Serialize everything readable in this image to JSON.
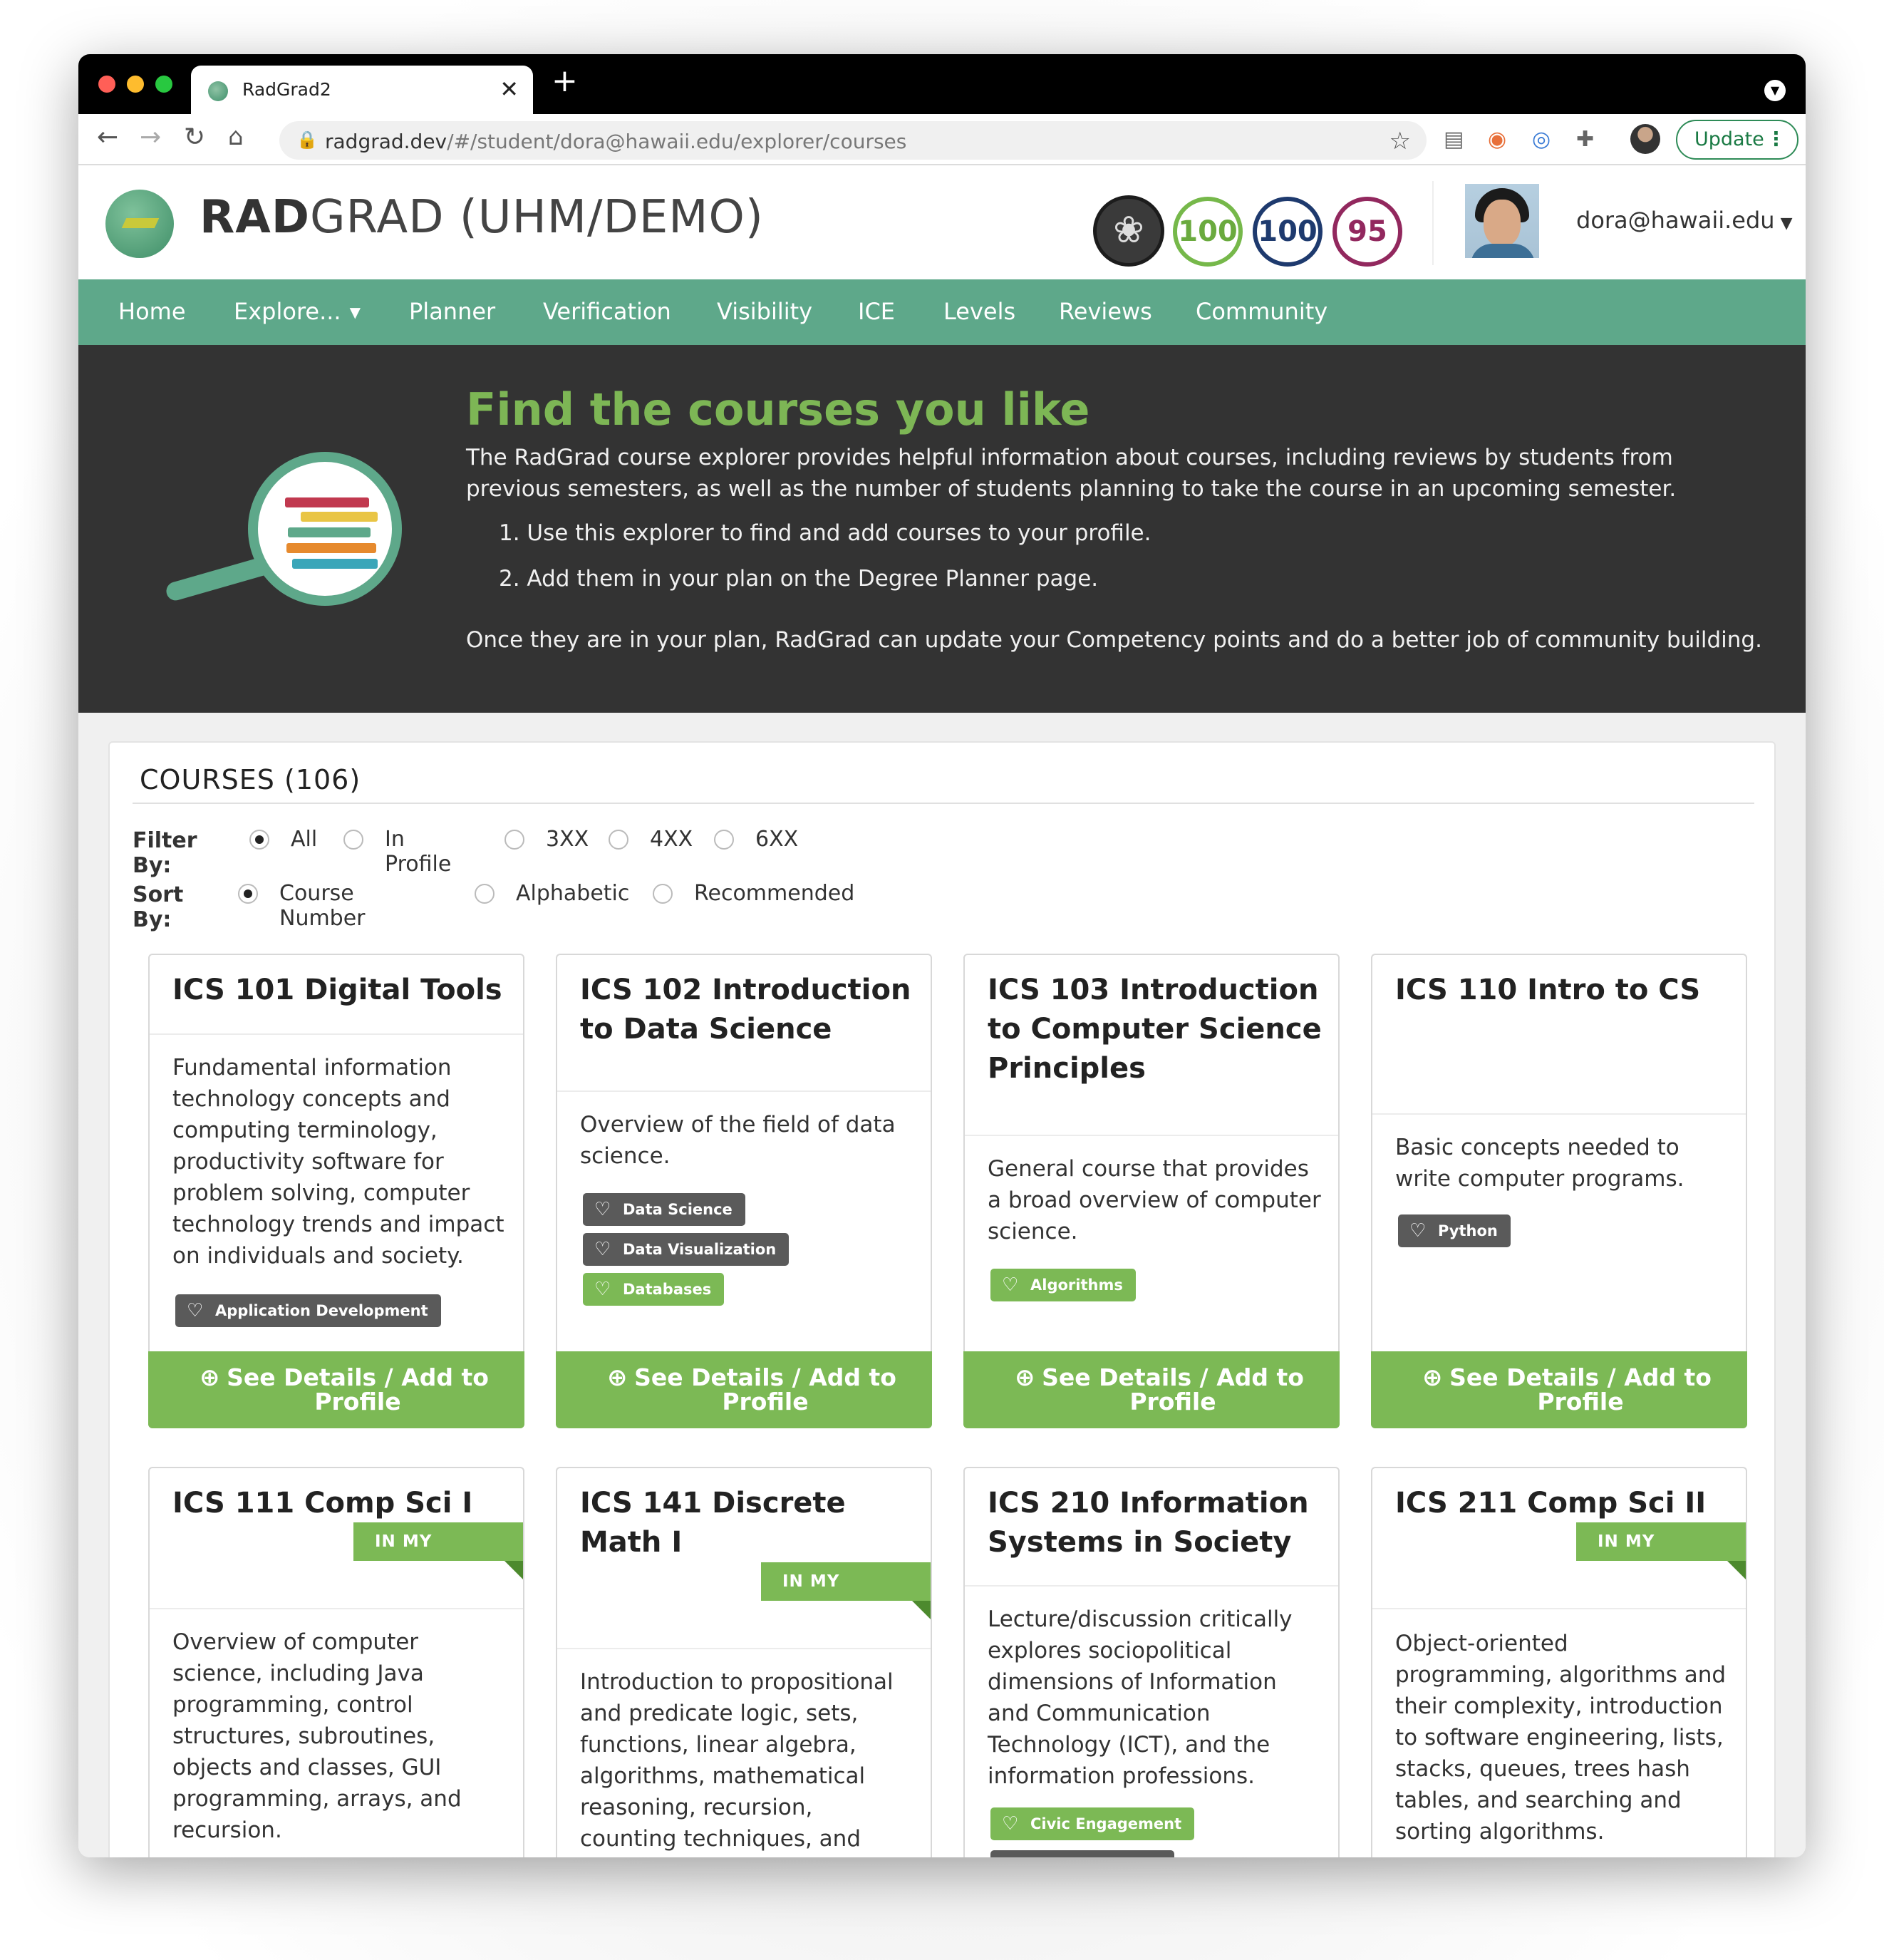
{
  "browser": {
    "tab_title": "RadGrad2",
    "tab_close": "✕",
    "new_tab": "+",
    "url_host": "radgrad.dev",
    "url_path": "/#/student/dora@hawaii.edu/explorer/courses",
    "update_label": "Update"
  },
  "header": {
    "brand_bold": "RAD",
    "brand_rest": "GRAD (UHM/DEMO)",
    "ice": {
      "innovation": "100",
      "competency": "100",
      "experience": "95"
    },
    "user_email": "dora@hawaii.edu"
  },
  "nav": {
    "items": [
      "Home",
      "Explore...",
      "Planner",
      "Verification",
      "Visibility",
      "ICE",
      "Levels",
      "Reviews",
      "Community"
    ]
  },
  "hero": {
    "title": "Find the courses you like",
    "intro": "The RadGrad course explorer provides helpful information about courses, including reviews by students from previous semesters, as well as the number of students planning to take the course in an upcoming semester.",
    "steps": [
      "1. Use this explorer to find and add courses to your profile.",
      "2. Add them in your plan on the Degree Planner page."
    ],
    "outro": "Once they are in your plan, RadGrad can update your Competency points and do a better job of community building."
  },
  "courses": {
    "title": "COURSES (106)",
    "filter_label": "Filter By:",
    "filter_options": [
      "All",
      "In Profile",
      "3XX",
      "4XX",
      "6XX"
    ],
    "filter_selected": "All",
    "sort_label": "Sort By:",
    "sort_options": [
      "Course Number",
      "Alphabetic",
      "Recommended"
    ],
    "sort_selected": "Course Number",
    "button_label": "See Details / Add to Profile",
    "in_profile_label": "IN MY PROFILE",
    "cards": [
      {
        "title": "ICS 101 Digital Tools",
        "description": "Fundamental information technology concepts and computing terminology, productivity software for problem solving, computer technology trends and impact on individuals and society.",
        "tags": [
          {
            "label": "Application Development",
            "style": "dark"
          }
        ],
        "in_profile": false
      },
      {
        "title": "ICS 102 Introduction to Data Science",
        "description": "Overview of the field of data science.",
        "tags": [
          {
            "label": "Data Science",
            "style": "dark"
          },
          {
            "label": "Data Visualization",
            "style": "dark"
          },
          {
            "label": "Databases",
            "style": "green"
          }
        ],
        "in_profile": false
      },
      {
        "title": "ICS 103 Introduction to Computer Science Principles",
        "description": "General course that provides a broad overview of computer science.",
        "tags": [
          {
            "label": "Algorithms",
            "style": "green"
          }
        ],
        "in_profile": false
      },
      {
        "title": "ICS 110 Intro to CS",
        "description": "Basic concepts needed to write computer programs.",
        "tags": [
          {
            "label": "Python",
            "style": "dark"
          }
        ],
        "in_profile": false
      },
      {
        "title": "ICS 111 Comp Sci I",
        "description": "Overview of computer science, including Java programming, control structures, subroutines, objects and classes, GUI programming, arrays, and recursion.",
        "tags": [],
        "in_profile": true
      },
      {
        "title": "ICS 141 Discrete Math I",
        "description": "Introduction to propositional and predicate logic, sets, functions, linear algebra, algorithms, mathematical reasoning, recursion, counting techniques, and probability",
        "tags": [],
        "in_profile": true
      },
      {
        "title": "ICS 210 Information Systems in Society",
        "description": "Lecture/discussion critically explores sociopolitical dimensions of Information and Communication Technology (ICT), and the information professions.",
        "tags": [
          {
            "label": "Civic Engagement",
            "style": "green"
          }
        ],
        "in_profile": false
      },
      {
        "title": "ICS 211 Comp Sci II",
        "description": "Object-oriented programming, algorithms and their complexity, introduction to software engineering, lists, stacks, queues, trees hash tables, and searching and sorting algorithms.",
        "tags": [],
        "in_profile": true
      }
    ]
  }
}
